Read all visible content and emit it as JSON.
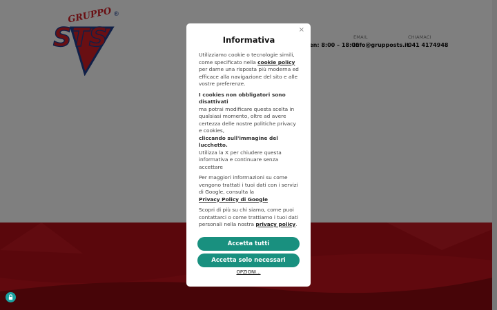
{
  "header": {
    "logo_text_top": "GRUPPO",
    "logo_text_main": "STS",
    "logo_registered": "®",
    "hours": {
      "value": "lun - ven: 8:00 – 18:00"
    },
    "email": {
      "label": "EMAIL",
      "value": "info@grupposts.it"
    },
    "phone": {
      "label": "CHIAMACI",
      "value": "041 4174948"
    }
  },
  "modal": {
    "title": "Informativa",
    "close_glyph": "×",
    "p1": {
      "text1": "Utilizziamo cookie o tecnologie simili, come specificato nella ",
      "link": "cookie policy",
      "text2": " per darne una risposta più moderna ed efficace alla navigazione del sito e alle vostre preferenze."
    },
    "p2": {
      "bold1": "I cookies non obbligatori sono disattivati",
      "text1": " ma potrai modificare questa scelta in qualsiasi momento, oltre ad avere certezza delle nostre politiche privacy e cookies,",
      "bold2": " cliccando sull'immagine del lucchetto.",
      "text2": " Utilizza la X per chiudere questa informativa e continuare senza accettare"
    },
    "p3": {
      "text1": "Per maggiori informazioni su come vengono trattati i tuoi dati con i servizi di Google, consulta la ",
      "link": "Privacy Policy di Google"
    },
    "p4": {
      "text1": "Scopri di più su chi siamo, come puoi contattarci o come trattiamo i tuoi dati personali nella nostra ",
      "link": "privacy policy",
      "text2": "."
    },
    "accept_all": "Accetta tutti",
    "accept_necessary": "Accetta solo necessari",
    "options": "OPZIONI..."
  },
  "colors": {
    "accent": "#19907f",
    "brand_red": "#d21f26",
    "brand_blue": "#1e3f8f",
    "lock_bg": "#1aa1a0"
  }
}
